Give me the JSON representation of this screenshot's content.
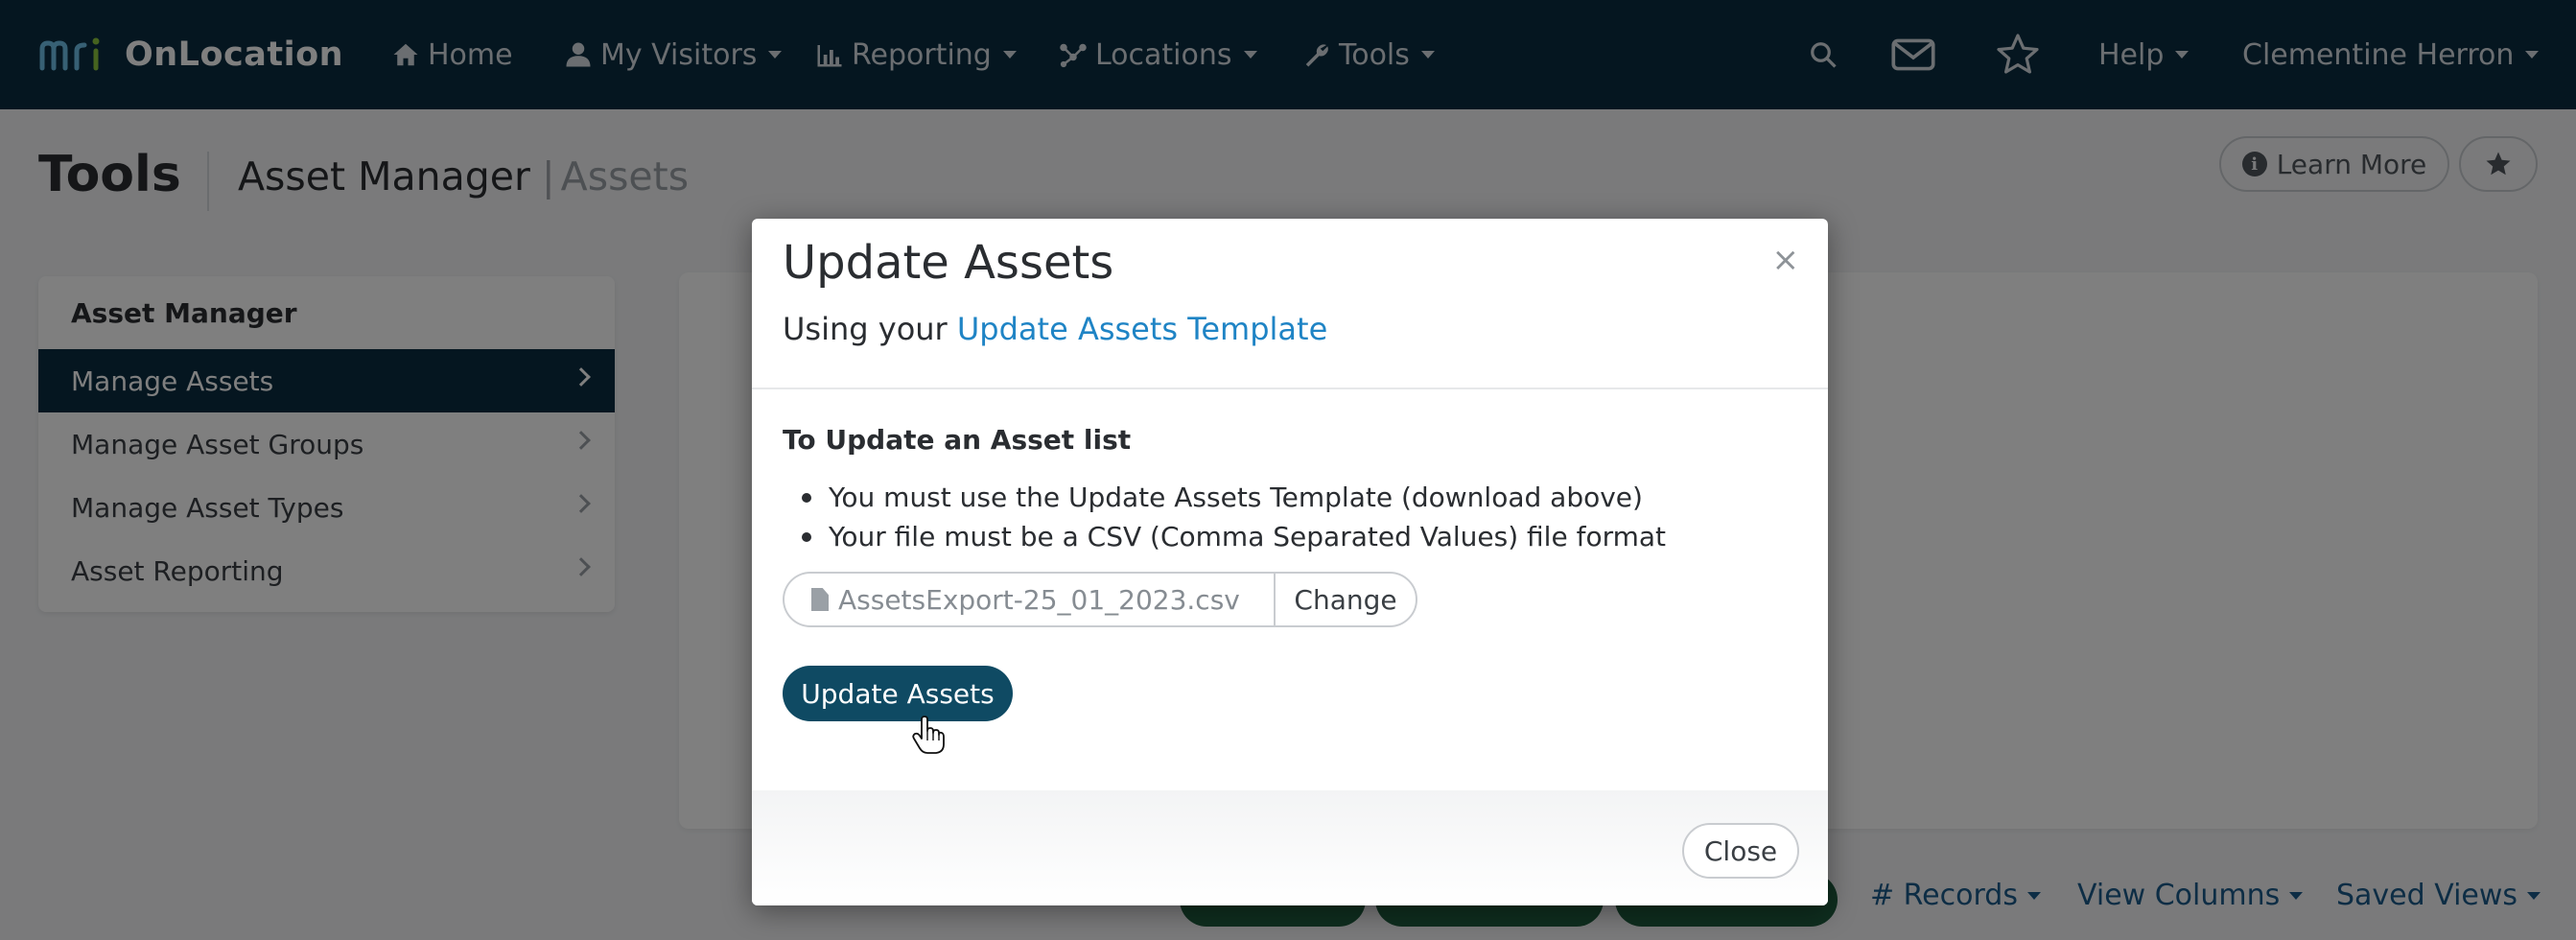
{
  "brand": {
    "logo_text": "mri",
    "product": "OnLocation"
  },
  "nav": {
    "home": "Home",
    "my_visitors": "My Visitors",
    "reporting": "Reporting",
    "locations": "Locations",
    "tools": "Tools",
    "help": "Help",
    "user": "Clementine Herron"
  },
  "header": {
    "title": "Tools",
    "section": "Asset Manager",
    "separator": "|",
    "crumb": "Assets",
    "learn_more": "Learn More"
  },
  "sidebar": {
    "heading": "Asset Manager",
    "items": [
      {
        "label": "Manage Assets",
        "active": true
      },
      {
        "label": "Manage Asset Groups",
        "active": false
      },
      {
        "label": "Manage Asset Types",
        "active": false
      },
      {
        "label": "Asset Reporting",
        "active": false
      }
    ]
  },
  "toolbar": {
    "records": "# Records",
    "view_columns": "View Columns",
    "saved_views": "Saved Views"
  },
  "modal": {
    "title": "Update Assets",
    "close_x": "×",
    "sub_prefix": "Using your",
    "template_link": "Update Assets Template",
    "section_heading": "To Update an Asset list",
    "rules": [
      "You must use the Update Assets Template (download above)",
      "Your file must be a CSV (Comma Separated Values) file format"
    ],
    "file_name": "AssetsExport-25_01_2023.csv",
    "change_label": "Change",
    "update_label": "Update Assets",
    "close_label": "Close"
  },
  "colors": {
    "nav_bg": "#0b2d40",
    "primary_button": "#0f4a63",
    "link": "#1f84c5",
    "brand_green": "#8cc63f"
  }
}
